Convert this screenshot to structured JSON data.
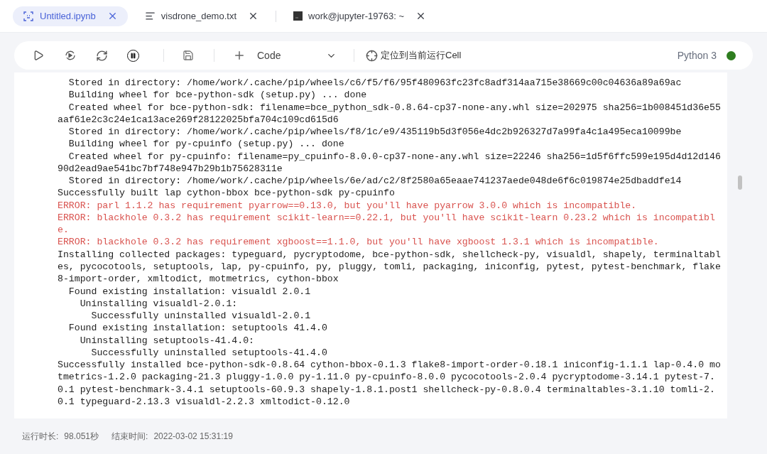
{
  "tabs": [
    {
      "label": "Untitled.ipynb",
      "kind": "notebook",
      "selected": true
    },
    {
      "label": "visdrone_demo.txt",
      "kind": "text",
      "selected": false
    },
    {
      "label": "work@jupyter-19763: ~",
      "kind": "terminal",
      "selected": false
    }
  ],
  "toolbar": {
    "cell_type": "Code",
    "locate": "定位到当前运行Cell",
    "kernel": "Python 3",
    "kernel_connected": true
  },
  "output": [
    {
      "kind": "normal",
      "text": "  Stored in directory: /home/work/.cache/pip/wheels/c6/f5/f6/95f480963fc23fc8adf314aa715e38669c00c04636a89a69ac"
    },
    {
      "kind": "normal",
      "text": "  Building wheel for bce-python-sdk (setup.py) ... done"
    },
    {
      "kind": "normal",
      "text": "  Created wheel for bce-python-sdk: filename=bce_python_sdk-0.8.64-cp37-none-any.whl size=202975 sha256=1b008451d36e55"
    },
    {
      "kind": "normal",
      "text": "aaf61e2c3c24e1ca13ace269f28122025bfa704c109cd615d6"
    },
    {
      "kind": "normal",
      "text": "  Stored in directory: /home/work/.cache/pip/wheels/f8/1c/e9/435119b5d3f056e4dc2b926327d7a99fa4c1a495eca10099be"
    },
    {
      "kind": "normal",
      "text": "  Building wheel for py-cpuinfo (setup.py) ... done"
    },
    {
      "kind": "normal",
      "text": "  Created wheel for py-cpuinfo: filename=py_cpuinfo-8.0.0-cp37-none-any.whl size=22246 sha256=1d5f6ffc599e195d4d12d146"
    },
    {
      "kind": "normal",
      "text": "90d2ead9ae541bc7bf748e947b29b1b75628311e"
    },
    {
      "kind": "normal",
      "text": "  Stored in directory: /home/work/.cache/pip/wheels/6e/ad/c2/8f2580a65eaae741237aede048de6f6c019874e25dbaddfe14"
    },
    {
      "kind": "normal",
      "text": "Successfully built lap cython-bbox bce-python-sdk py-cpuinfo"
    },
    {
      "kind": "error",
      "text": "ERROR: parl 1.1.2 has requirement pyarrow==0.13.0, but you'll have pyarrow 3.0.0 which is incompatible."
    },
    {
      "kind": "error",
      "text": "ERROR: blackhole 0.3.2 has requirement scikit-learn==0.22.1, but you'll have scikit-learn 0.23.2 which is incompatibl"
    },
    {
      "kind": "error",
      "text": "e."
    },
    {
      "kind": "error",
      "text": "ERROR: blackhole 0.3.2 has requirement xgboost==1.1.0, but you'll have xgboost 1.3.1 which is incompatible."
    },
    {
      "kind": "normal",
      "text": "Installing collected packages: typeguard, pycryptodome, bce-python-sdk, shellcheck-py, visualdl, shapely, terminaltabl"
    },
    {
      "kind": "normal",
      "text": "es, pycocotools, setuptools, lap, py-cpuinfo, py, pluggy, tomli, packaging, iniconfig, pytest, pytest-benchmark, flake"
    },
    {
      "kind": "normal",
      "text": "8-import-order, xmltodict, motmetrics, cython-bbox"
    },
    {
      "kind": "normal",
      "text": "  Found existing installation: visualdl 2.0.1"
    },
    {
      "kind": "normal",
      "text": "    Uninstalling visualdl-2.0.1:"
    },
    {
      "kind": "normal",
      "text": "      Successfully uninstalled visualdl-2.0.1"
    },
    {
      "kind": "normal",
      "text": "  Found existing installation: setuptools 41.4.0"
    },
    {
      "kind": "normal",
      "text": "    Uninstalling setuptools-41.4.0:"
    },
    {
      "kind": "normal",
      "text": "      Successfully uninstalled setuptools-41.4.0"
    },
    {
      "kind": "normal",
      "text": "Successfully installed bce-python-sdk-0.8.64 cython-bbox-0.1.3 flake8-import-order-0.18.1 iniconfig-1.1.1 lap-0.4.0 mo"
    },
    {
      "kind": "normal",
      "text": "tmetrics-1.2.0 packaging-21.3 pluggy-1.0.0 py-1.11.0 py-cpuinfo-8.0.0 pycocotools-2.0.4 pycryptodome-3.14.1 pytest-7."
    },
    {
      "kind": "normal",
      "text": "0.1 pytest-benchmark-3.4.1 setuptools-60.9.3 shapely-1.8.1.post1 shellcheck-py-0.8.0.4 terminaltables-3.1.10 tomli-2."
    },
    {
      "kind": "normal",
      "text": "0.1 typeguard-2.13.3 visualdl-2.2.3 xmltodict-0.12.0"
    }
  ],
  "footer": {
    "duration_label": "运行时长:",
    "duration": "98.051秒",
    "end_label": "结束时间:",
    "end_time": "2022-03-02 15:31:19"
  }
}
